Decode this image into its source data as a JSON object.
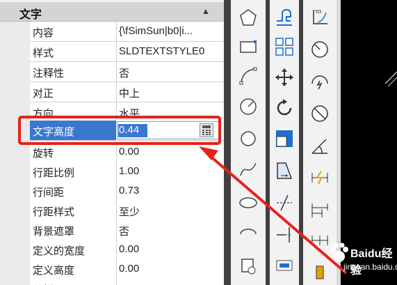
{
  "properties": {
    "category": "文字",
    "rows": [
      {
        "label": "内容",
        "value": "{\\fSimSun|b0|i..."
      },
      {
        "label": "样式",
        "value": "SLDTEXTSTYLE0"
      },
      {
        "label": "注释性",
        "value": "否"
      },
      {
        "label": "对正",
        "value": "中上"
      },
      {
        "label": "方向",
        "value": "水平"
      },
      {
        "label": "文字高度",
        "value": "0.44"
      },
      {
        "label": "旋转",
        "value": "0.00"
      },
      {
        "label": "行距比例",
        "value": "1.00"
      },
      {
        "label": "行间距",
        "value": "0.73"
      },
      {
        "label": "行距样式",
        "value": "至少"
      },
      {
        "label": "背景遮罩",
        "value": "否"
      },
      {
        "label": "定义的宽度",
        "value": "0.00"
      },
      {
        "label": "定义高度",
        "value": "0.00"
      },
      {
        "label": "分栏",
        "value": ""
      }
    ],
    "selected_index": 5
  },
  "watermark": {
    "brand": "Baidu经验",
    "url": "jingyan.baidu.com"
  },
  "colors": {
    "selection": "#3a78d0",
    "highlight_box": "#e8221b",
    "accent_blue": "#1e6fd0"
  }
}
